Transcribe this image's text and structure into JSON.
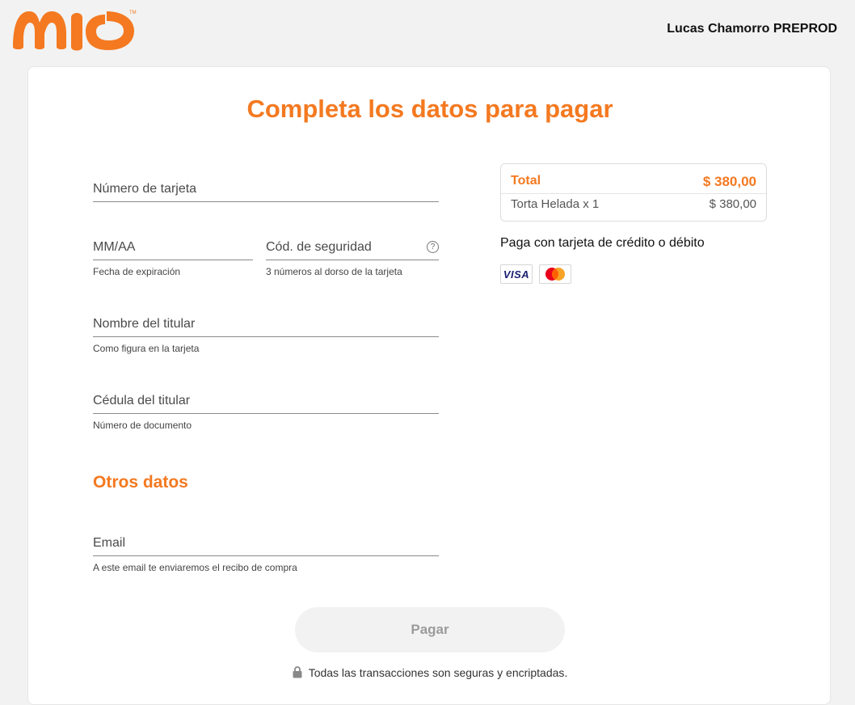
{
  "header": {
    "user_name": "Lucas Chamorro PREPROD"
  },
  "page": {
    "title": "Completa los datos para pagar"
  },
  "form": {
    "card_number": {
      "placeholder": "Número de tarjeta",
      "value": ""
    },
    "expiry": {
      "placeholder": "MM/AA",
      "hint": "Fecha de expiración",
      "value": ""
    },
    "cvv": {
      "placeholder": "Cód. de seguridad",
      "hint": "3 números al dorso de la tarjeta",
      "value": ""
    },
    "holder_name": {
      "placeholder": "Nombre del titular",
      "hint": "Como figura en la tarjeta",
      "value": ""
    },
    "holder_id": {
      "placeholder": "Cédula del titular",
      "hint": "Número de documento",
      "value": ""
    },
    "other_title": "Otros datos",
    "email": {
      "placeholder": "Email",
      "hint": "A este email te enviaremos el recibo de compra",
      "value": ""
    },
    "pay_label": "Pagar",
    "secure_note": "Todas las transacciones son seguras y encriptadas."
  },
  "summary": {
    "total_label": "Total",
    "total_amount": "$ 380,00",
    "items": [
      {
        "label": "Torta Helada x 1",
        "amount": "$ 380,00"
      }
    ]
  },
  "payment_methods": {
    "note": "Paga con tarjeta de crédito o débito",
    "brands": [
      {
        "name": "visa-icon",
        "text": "VISA"
      },
      {
        "name": "mastercard-icon"
      }
    ]
  },
  "colors": {
    "accent": "#f47920",
    "background": "#f2f2f2"
  }
}
